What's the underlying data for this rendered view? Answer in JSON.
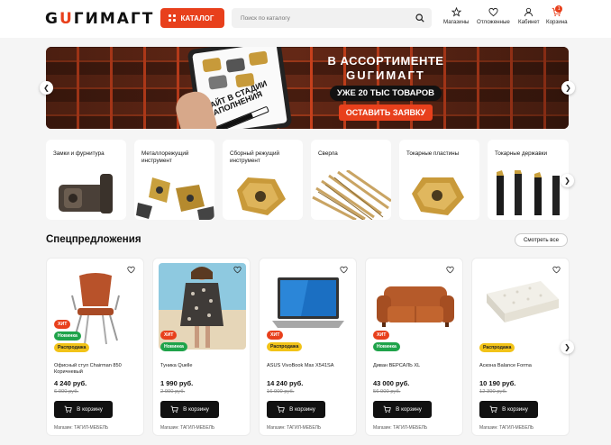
{
  "header": {
    "logo": {
      "part1": "G",
      "accent": "U",
      "part2": "ГИМАГТ"
    },
    "catalog_label": "КАТАЛОГ",
    "search_placeholder": "Поиск по каталогу",
    "icons": [
      {
        "name": "star-icon",
        "label": "Магазины"
      },
      {
        "name": "heart-icon",
        "label": "Отложенные"
      },
      {
        "name": "user-icon",
        "label": "Кабинет"
      },
      {
        "name": "cart-icon",
        "label": "Корзина",
        "badge": "1"
      }
    ]
  },
  "banner": {
    "tablet_text_1": "САЙТ В СТАДИИ",
    "tablet_text_2": "НАПОЛНЕНИЯ",
    "line1": "В АССОРТИМЕНТЕ",
    "line2": "GUГИМАГТ",
    "line3": "УЖЕ 20 ТЫС ТОВАРОВ",
    "cta": "ОСТАВИТЬ ЗАЯВКУ"
  },
  "categories": [
    {
      "label": "Замки и фурнитура"
    },
    {
      "label": "Металлорежущий инструмент"
    },
    {
      "label": "Сборный режущий инструмент"
    },
    {
      "label": "Сверла"
    },
    {
      "label": "Токарные пластины"
    },
    {
      "label": "Токарные державки"
    }
  ],
  "special": {
    "title": "Спецпредложения",
    "see_all": "Смотреть все"
  },
  "products": [
    {
      "name": "Офисный стул Chairman 850 Коричневый",
      "price": "4 240 руб.",
      "old": "6 900 руб.",
      "badges": [
        "ХИТ",
        "Новинка",
        "Распродажа"
      ],
      "cart": "В корзину",
      "shop": "Магазин: ТАГИЛ-МЕБЕЛЬ"
    },
    {
      "name": "Туника Quelle",
      "price": "1 990 руб.",
      "old": "2 900 руб.",
      "badges": [
        "ХИТ",
        "Новинка"
      ],
      "cart": "В корзину",
      "shop": "Магазин: ТАГИЛ-МЕБЕЛЬ"
    },
    {
      "name": "ASUS VivoBook Max X541SA",
      "price": "14 240 руб.",
      "old": "16 900 руб.",
      "badges": [
        "ХИТ",
        "Распродажа"
      ],
      "cart": "В корзину",
      "shop": "Магазин: ТАГИЛ-МЕБЕЛЬ"
    },
    {
      "name": "Диван ВЕРСАЛЬ XL",
      "price": "43 000 руб.",
      "old": "56 900 руб.",
      "badges": [
        "ХИТ",
        "Новинка"
      ],
      "cart": "В корзину",
      "shop": "Магазин: ТАГИЛ-МЕБЕЛЬ"
    },
    {
      "name": "Аскона Balance Forma",
      "price": "10 190 руб.",
      "old": "12 390 руб.",
      "badges": [
        "Распродажа"
      ],
      "cart": "В корзину",
      "shop": "Магазин: ТАГИЛ-МЕБЕЛЬ"
    }
  ],
  "colors": {
    "accent": "#e8401c",
    "hit": "#e8401c",
    "new": "#1fa34a",
    "sale": "#f2c318"
  }
}
